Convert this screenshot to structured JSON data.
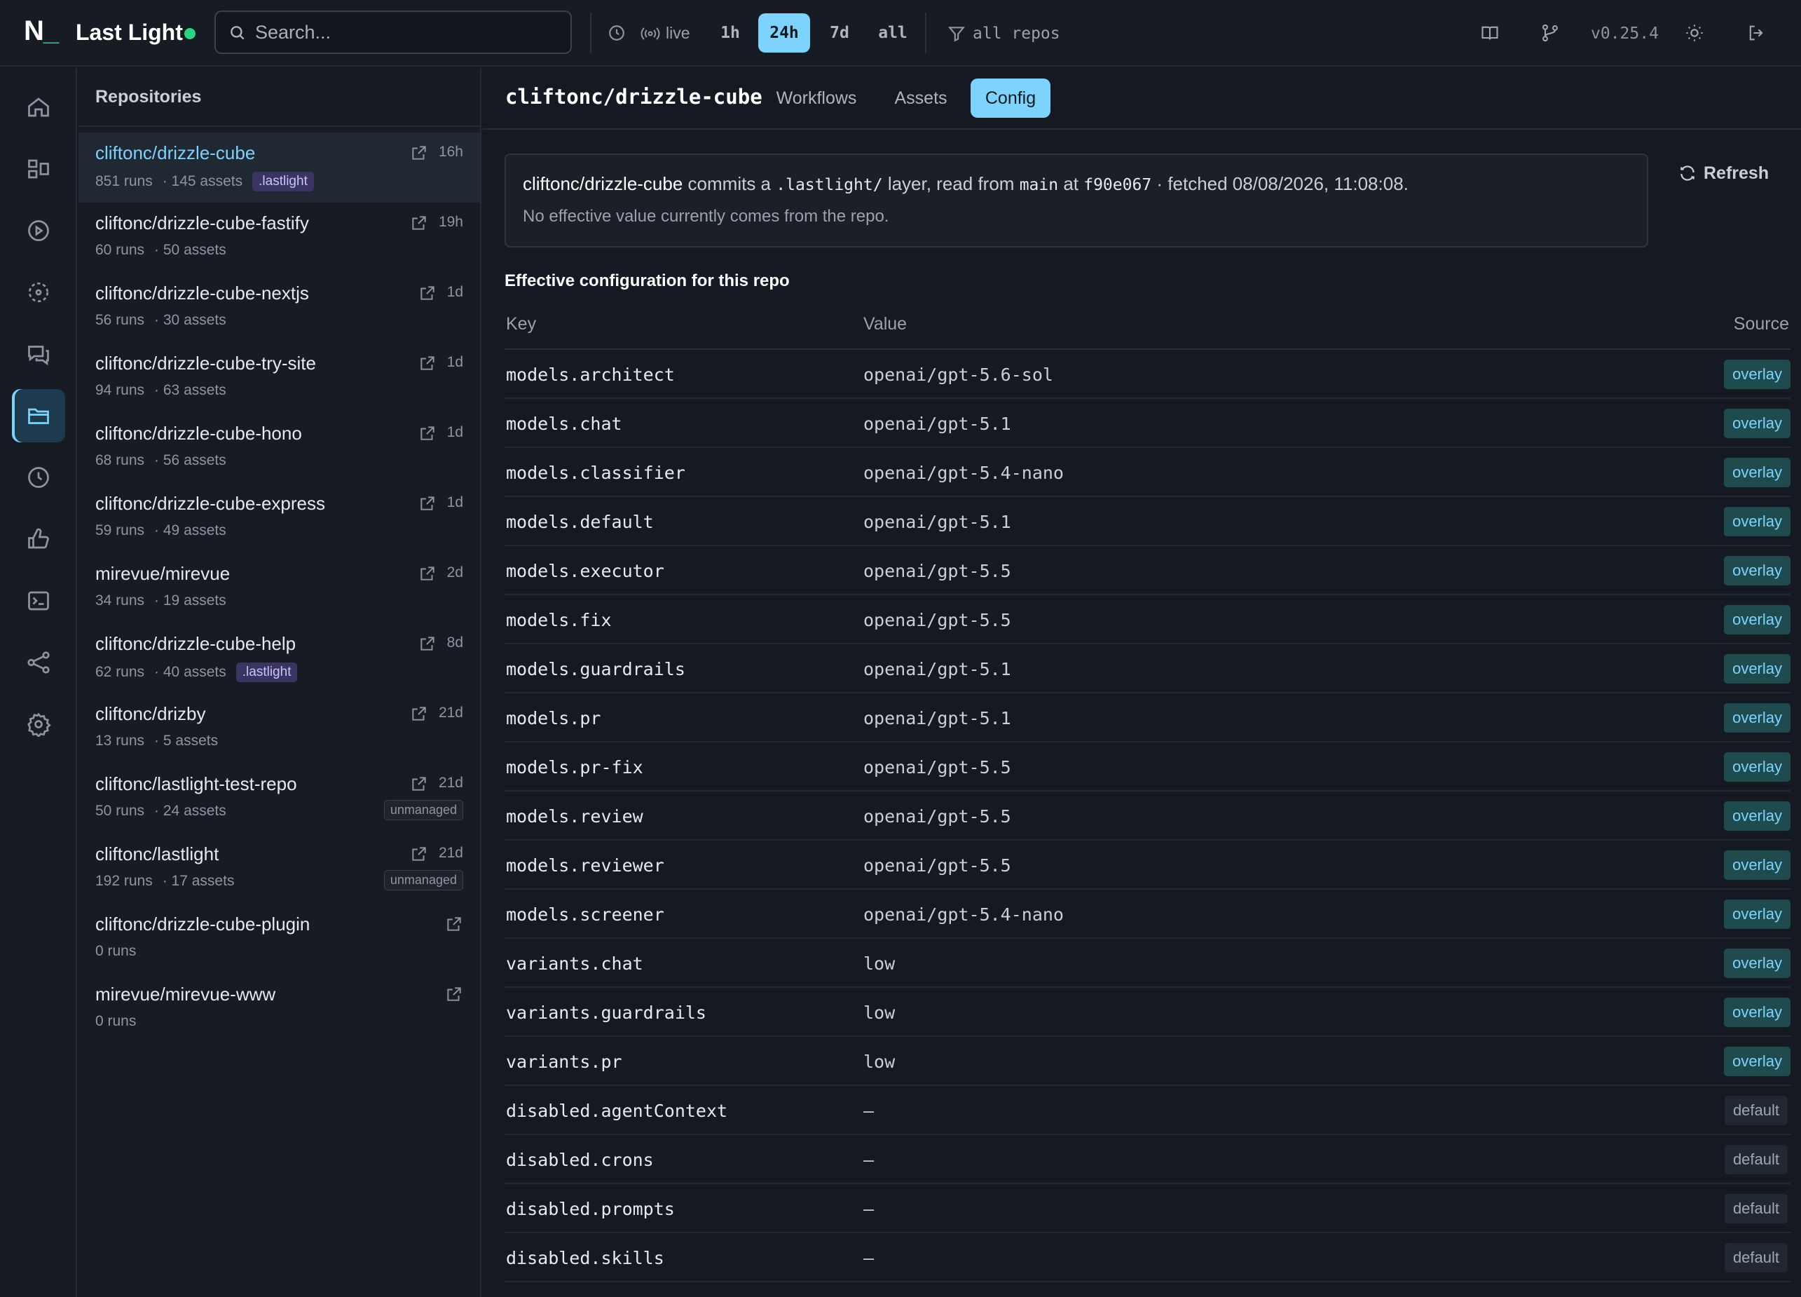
{
  "app": {
    "logo": "N",
    "logo_suffix": "_",
    "name": "Last Light"
  },
  "search": {
    "placeholder": "Search..."
  },
  "topbar": {
    "live_label": "live",
    "ranges": [
      "1h",
      "24h",
      "7d",
      "all"
    ],
    "active_range": "24h",
    "repo_filter": "all repos",
    "version": "v0.25.4"
  },
  "repos": {
    "header": "Repositories",
    "items": [
      {
        "name": "cliftonc/drizzle-cube",
        "runs": "851 runs",
        "assets": "· 145 assets",
        "tag": ".lastlight",
        "age": "16h",
        "active": true
      },
      {
        "name": "cliftonc/drizzle-cube-fastify",
        "runs": "60 runs",
        "assets": "· 50 assets",
        "age": "19h"
      },
      {
        "name": "cliftonc/drizzle-cube-nextjs",
        "runs": "56 runs",
        "assets": "· 30 assets",
        "age": "1d"
      },
      {
        "name": "cliftonc/drizzle-cube-try-site",
        "runs": "94 runs",
        "assets": "· 63 assets",
        "age": "1d"
      },
      {
        "name": "cliftonc/drizzle-cube-hono",
        "runs": "68 runs",
        "assets": "· 56 assets",
        "age": "1d"
      },
      {
        "name": "cliftonc/drizzle-cube-express",
        "runs": "59 runs",
        "assets": "· 49 assets",
        "age": "1d"
      },
      {
        "name": "mirevue/mirevue",
        "runs": "34 runs",
        "assets": "· 19 assets",
        "age": "2d"
      },
      {
        "name": "cliftonc/drizzle-cube-help",
        "runs": "62 runs",
        "assets": "· 40 assets",
        "tag": ".lastlight",
        "age": "8d"
      },
      {
        "name": "cliftonc/drizby",
        "runs": "13 runs",
        "assets": "· 5 assets",
        "age": "21d"
      },
      {
        "name": "cliftonc/lastlight-test-repo",
        "runs": "50 runs",
        "assets": "· 24 assets",
        "age": "21d",
        "status": "unmanaged"
      },
      {
        "name": "cliftonc/lastlight",
        "runs": "192 runs",
        "assets": "· 17 assets",
        "age": "21d",
        "status": "unmanaged"
      },
      {
        "name": "cliftonc/drizzle-cube-plugin",
        "runs": "0 runs",
        "assets": "",
        "age": ""
      },
      {
        "name": "mirevue/mirevue-www",
        "runs": "0 runs",
        "assets": "",
        "age": ""
      }
    ]
  },
  "main": {
    "title": "cliftonc/drizzle-cube",
    "tabs": [
      "Workflows",
      "Assets",
      "Config"
    ],
    "active_tab": "Config",
    "info": {
      "repo": "cliftonc/drizzle-cube",
      "t1": "commits a",
      "layer": ".lastlight/",
      "t2": "layer, read from",
      "branch": "main",
      "t3": "at",
      "sha": "f90e067",
      "t4": "· fetched 08/08/2026, 11:08:08.",
      "line2": "No effective value currently comes from the repo."
    },
    "refresh_label": "Refresh",
    "section_title": "Effective configuration for this repo",
    "table": {
      "headers": {
        "key": "Key",
        "value": "Value",
        "source": "Source"
      },
      "rows": [
        {
          "key": "models.architect",
          "value": "openai/gpt-5.6-sol",
          "source": "overlay"
        },
        {
          "key": "models.chat",
          "value": "openai/gpt-5.1",
          "source": "overlay"
        },
        {
          "key": "models.classifier",
          "value": "openai/gpt-5.4-nano",
          "source": "overlay"
        },
        {
          "key": "models.default",
          "value": "openai/gpt-5.1",
          "source": "overlay"
        },
        {
          "key": "models.executor",
          "value": "openai/gpt-5.5",
          "source": "overlay"
        },
        {
          "key": "models.fix",
          "value": "openai/gpt-5.5",
          "source": "overlay"
        },
        {
          "key": "models.guardrails",
          "value": "openai/gpt-5.1",
          "source": "overlay"
        },
        {
          "key": "models.pr",
          "value": "openai/gpt-5.1",
          "source": "overlay"
        },
        {
          "key": "models.pr-fix",
          "value": "openai/gpt-5.5",
          "source": "overlay"
        },
        {
          "key": "models.review",
          "value": "openai/gpt-5.5",
          "source": "overlay"
        },
        {
          "key": "models.reviewer",
          "value": "openai/gpt-5.5",
          "source": "overlay"
        },
        {
          "key": "models.screener",
          "value": "openai/gpt-5.4-nano",
          "source": "overlay"
        },
        {
          "key": "variants.chat",
          "value": "low",
          "source": "overlay"
        },
        {
          "key": "variants.guardrails",
          "value": "low",
          "source": "overlay"
        },
        {
          "key": "variants.pr",
          "value": "low",
          "source": "overlay"
        },
        {
          "key": "disabled.agentContext",
          "value": "—",
          "source": "default"
        },
        {
          "key": "disabled.crons",
          "value": "—",
          "source": "default"
        },
        {
          "key": "disabled.prompts",
          "value": "—",
          "source": "default"
        },
        {
          "key": "disabled.skills",
          "value": "—",
          "source": "default"
        }
      ]
    }
  },
  "colors": {
    "accent": "#7dd3fc",
    "live": "#2bd47f",
    "brand": "#2bd4a0",
    "overlay_bg": "#1f4b4f",
    "lastlight_tag_bg": "#3a3560"
  },
  "icons": {
    "rail": [
      "home-icon",
      "layout-icon",
      "play-circle-icon",
      "scan-icon",
      "chat-bubbles-icon",
      "folder-icon",
      "clock-icon",
      "thumbs-up-icon",
      "terminal-icon",
      "share-icon",
      "gear-icon"
    ],
    "topbar": [
      "search-icon",
      "clock-icon",
      "broadcast-icon",
      "filter-icon",
      "book-icon",
      "git-branch-icon",
      "sun-icon",
      "logout-icon"
    ]
  }
}
